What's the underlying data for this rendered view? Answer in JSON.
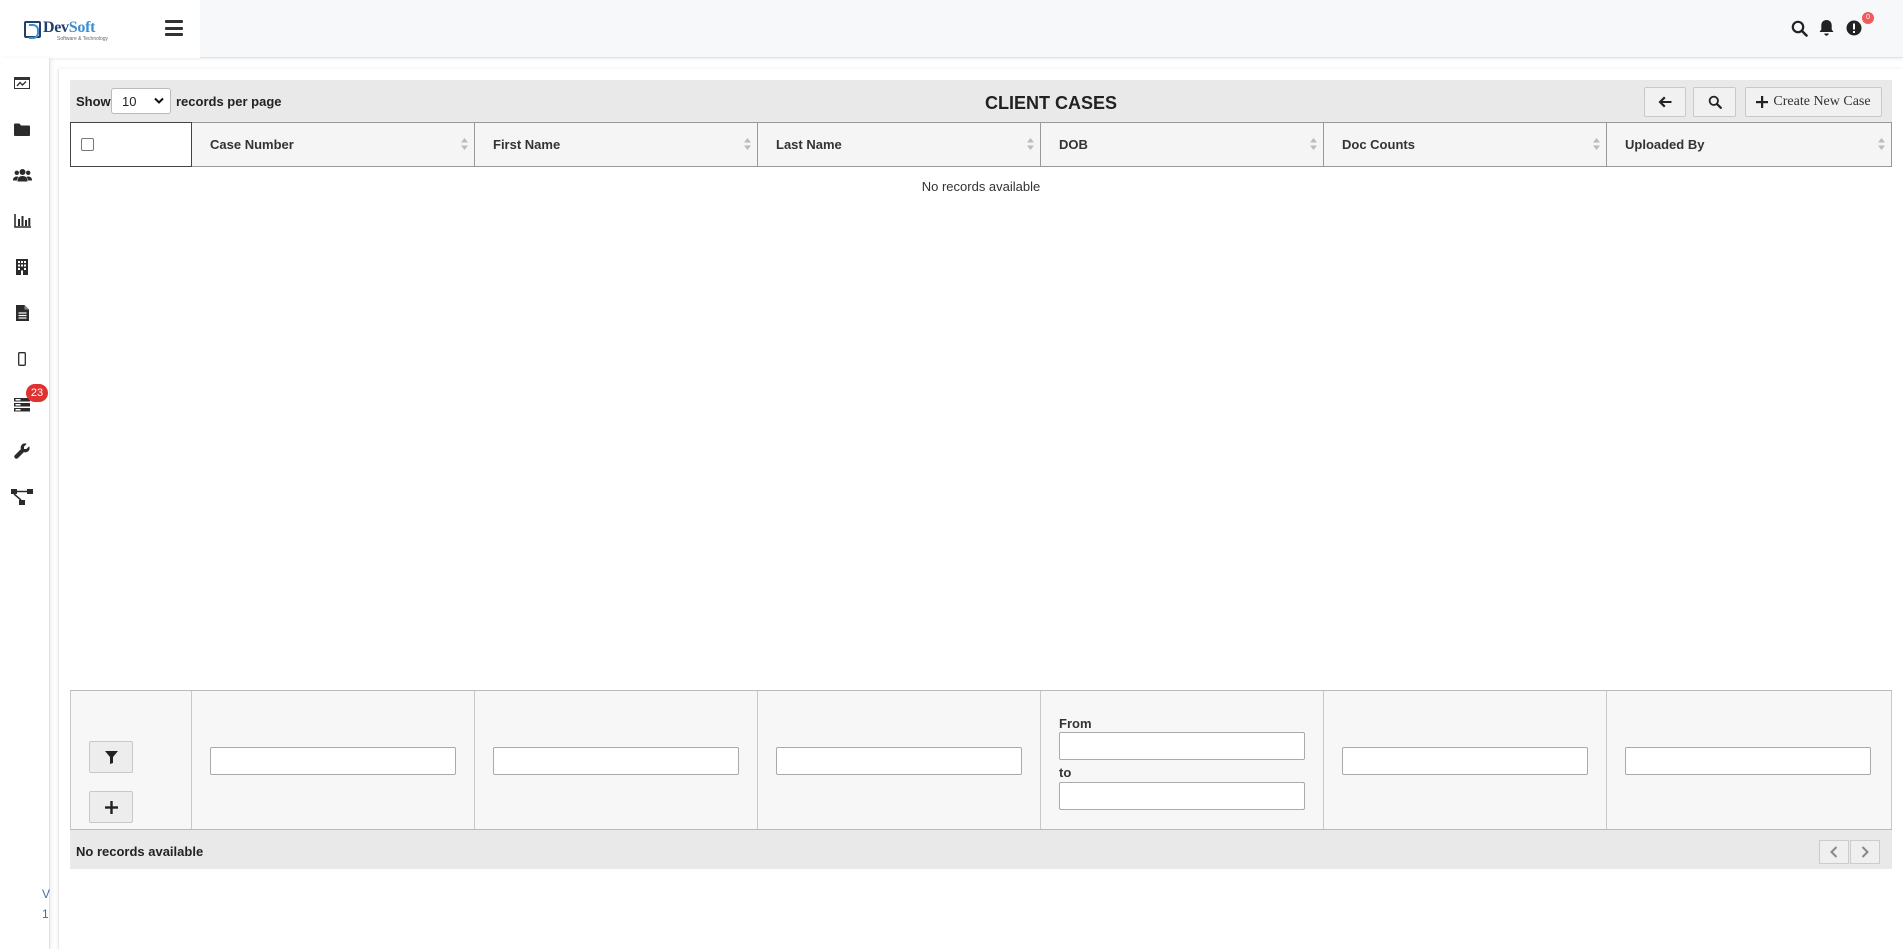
{
  "brand": {
    "name_part1": "Dev",
    "name_part2": "Soft",
    "tagline": "Software & Technology"
  },
  "header": {
    "icons": [
      "search-icon",
      "bell-icon",
      "alert-icon"
    ],
    "alert_badge": "0"
  },
  "sidebar": {
    "items": [
      {
        "icon": "dashboard-icon"
      },
      {
        "icon": "folder-icon"
      },
      {
        "icon": "users-icon"
      },
      {
        "icon": "bar-chart-icon"
      },
      {
        "icon": "building-icon"
      },
      {
        "icon": "document-icon"
      },
      {
        "icon": "mobile-icon"
      },
      {
        "icon": "queue-icon",
        "badge": "23"
      },
      {
        "icon": "wrench-icon"
      },
      {
        "icon": "sitemap-icon"
      }
    ],
    "version_line1": "V",
    "version_line2": "1"
  },
  "toolbar": {
    "show_label": "Show",
    "records_per_page_value": "10",
    "records_per_page_label": "records per page",
    "title": "CLIENT CASES",
    "create_label": "Create New Case"
  },
  "table": {
    "columns": [
      "Case Number",
      "First Name",
      "Last Name",
      "DOB",
      "Doc Counts",
      "Uploaded By"
    ],
    "empty_message": "No records available"
  },
  "filters": {
    "dob_from_label": "From",
    "dob_to_label": "to"
  },
  "footer": {
    "status": "No records available"
  },
  "colors": {
    "brand_dark": "#23406b",
    "brand_light": "#3a8ed6",
    "badge_red": "#e03030"
  }
}
